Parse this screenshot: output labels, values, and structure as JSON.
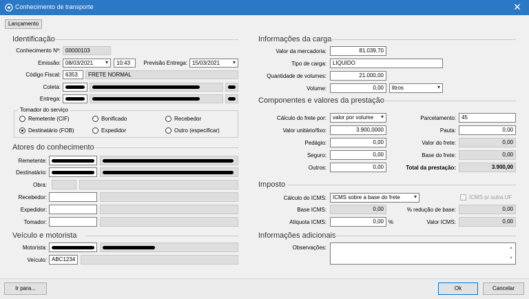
{
  "window": {
    "title": "Conhecimento de transporte",
    "close_glyph": "✕"
  },
  "toolbar": {
    "lancamento": "Lançamento"
  },
  "identificacao": {
    "title": "Identificação",
    "conhecimento_label": "Conhecimento Nº:",
    "conhecimento_value": "00000103",
    "emissao_label": "Emissão:",
    "emissao_date": "08/03/2021",
    "emissao_time": "10:43",
    "previsao_label": "Previsão Entrega:",
    "previsao_date": "15/03/2021",
    "cfop_label": "Código Fiscal:",
    "cfop_code": "6353",
    "cfop_desc": "FRETE NORMAL",
    "coleta_label": "Coleta:",
    "entrega_label": "Entrega:"
  },
  "tomador": {
    "title": "Tomador do serviço",
    "options": [
      {
        "label": "Remetente (CIF)",
        "selected": false
      },
      {
        "label": "Bonificado",
        "selected": false
      },
      {
        "label": "Recebedor",
        "selected": false
      },
      {
        "label": "Destinatário (FOB)",
        "selected": true
      },
      {
        "label": "Expedidor",
        "selected": false
      },
      {
        "label": "Outro (especificar)",
        "selected": false
      }
    ]
  },
  "atores": {
    "title": "Atores do conhecimento",
    "remetente_label": "Remetente:",
    "destinatario_label": "Destinatário:",
    "obra_label": "Obra:",
    "recebedor_label": "Recebedor:",
    "expedidor_label": "Expedidor:",
    "tomador_label": "Tomador:"
  },
  "veiculo": {
    "title": "Veículo e motorista",
    "motorista_label": "Motorista:",
    "veiculo_label": "Veículo:",
    "veiculo_value": "ABC1234"
  },
  "carga": {
    "title": "Informações da carga",
    "valor_label": "Valor da mercadoria:",
    "valor_value": "81.039,70",
    "tipo_label": "Tipo de carga:",
    "tipo_value": "LIQUIDO",
    "quantidade_label": "Quantidade de volumes:",
    "quantidade_value": "21.000,00",
    "volume_label": "Volume:",
    "volume_value": "0,00",
    "volume_unit": "litros"
  },
  "componentes": {
    "title": "Componentes e valores da prestação",
    "calculo_label": "Cálculo do frete por:",
    "calculo_value": "valor por volume",
    "valor_unit_label": "Valor unitário/fixo:",
    "valor_unit_value": "3.900,0000",
    "pedagio_label": "Pedágio:",
    "pedagio_value": "0,00",
    "seguro_label": "Seguro:",
    "seguro_value": "0,00",
    "outros_label": "Outros:",
    "outros_value": "0,00",
    "parcelamento_label": "Parcelamento:",
    "parcelamento_value": "45",
    "pauta_label": "Pauta:",
    "pauta_value": "0,00",
    "valor_frete_label": "Valor do frete:",
    "valor_frete_value": "0,00",
    "base_frete_label": "Base do frete:",
    "base_frete_value": "0,00",
    "total_label": "Total da prestação:",
    "total_value": "3.900,00"
  },
  "imposto": {
    "title": "Imposto",
    "calculo_label": "Cálculo do ICMS:",
    "calculo_value": "ICMS sobre a base do frete",
    "outra_uf_label": "ICMS p/ outra UF",
    "base_label": "Base ICMS:",
    "base_value": "0,00",
    "reducao_label": "% redução de base:",
    "reducao_value": "0,00",
    "aliquota_label": "Alíquota ICMS:",
    "aliquota_value": "0,00",
    "percent": "%",
    "valor_label": "Valor ICMS:",
    "valor_value": "0,00"
  },
  "adicionais": {
    "title": "Informações adicionais",
    "obs_label": "Observações:"
  },
  "footer": {
    "ir_para": "Ir para...",
    "ok": "Ok",
    "cancelar": "Cancelar"
  },
  "colors": {
    "titlebar": "#2a78c6",
    "readonly": "#dedede",
    "default_button_border": "#0078d7"
  }
}
